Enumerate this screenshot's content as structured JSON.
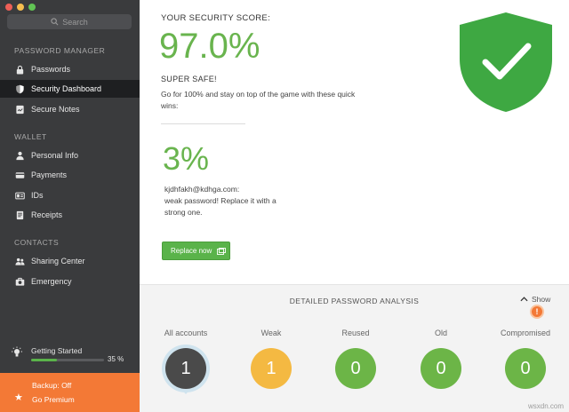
{
  "sidebar": {
    "search_placeholder": "Search",
    "sections": {
      "password_manager": "PASSWORD MANAGER",
      "wallet": "WALLET",
      "contacts": "CONTACTS"
    },
    "items": {
      "passwords": "Passwords",
      "security_dashboard": "Security Dashboard",
      "secure_notes": "Secure Notes",
      "personal_info": "Personal Info",
      "payments": "Payments",
      "ids": "IDs",
      "receipts": "Receipts",
      "sharing_center": "Sharing Center",
      "emergency": "Emergency"
    },
    "active_item": "security_dashboard",
    "getting_started": {
      "label": "Getting Started",
      "progress_text": "35 %",
      "progress_fraction": 0.35
    },
    "premium": {
      "backup": "Backup: Off",
      "go": "Go Premium"
    }
  },
  "main": {
    "score_label": "YOUR SECURITY SCORE:",
    "score_value": "97.0%",
    "status": "SUPER SAFE!",
    "hint": "Go for 100% and stay on top of the game with these quick wins:",
    "item": {
      "percent": "3%",
      "email": "kjdhfakh@kdhga.com:",
      "message": "weak password! Replace it with a strong one.",
      "button": "Replace now"
    }
  },
  "analysis": {
    "title": "DETAILED PASSWORD ANALYSIS",
    "show": "Show",
    "badge": "!",
    "metrics": [
      {
        "label": "All accounts",
        "value": "1",
        "color": "#4a4a4a"
      },
      {
        "label": "Weak",
        "value": "1",
        "color": "#f4b942"
      },
      {
        "label": "Reused",
        "value": "0",
        "color": "#6cb547"
      },
      {
        "label": "Old",
        "value": "0",
        "color": "#6cb547"
      },
      {
        "label": "Compromised",
        "value": "0",
        "color": "#6cb547"
      }
    ]
  },
  "colors": {
    "accent_green": "#69b44e",
    "shield_green": "#3ea842",
    "premium_orange": "#f37936"
  },
  "watermark": "wsxdn.com"
}
